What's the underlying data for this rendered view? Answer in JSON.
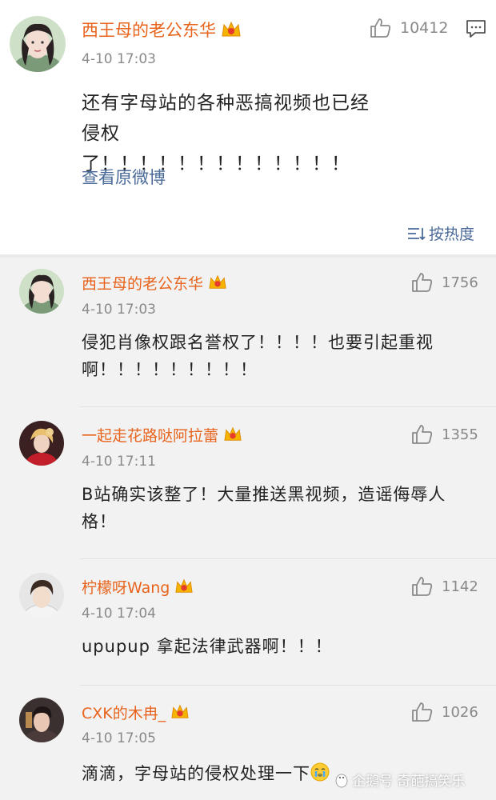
{
  "main_comment": {
    "username": "西王母的老公东华",
    "time": "4-10 17:03",
    "likes": "10412",
    "text": "还有字母站的各种恶搞视频也已经侵权了！！！！！！！！！！！！！",
    "view_original": "查看原微博",
    "sort_label": "按热度"
  },
  "comments": [
    {
      "username": "西王母的老公东华",
      "time": "4-10 17:03",
      "likes": "1756",
      "text": "侵犯肖像权跟名誉权了！！！！也要引起重视啊！！！！！！！！！"
    },
    {
      "username": "一起走花路哒阿拉蕾",
      "time": "4-10 17:11",
      "likes": "1355",
      "text": "B站确实该整了！大量推送黑视频，造谣侮辱人格！"
    },
    {
      "username": "柠檬呀Wang",
      "time": "4-10 17:04",
      "likes": "1142",
      "text": "upupup 拿起法律武器啊！！！"
    },
    {
      "username": "CXK的木冉_",
      "time": "4-10 17:05",
      "likes": "1026",
      "text": "滴滴，字母站的侵权处理一下"
    }
  ],
  "watermark": "企鹅号 奇葩搞笑乐",
  "colors": {
    "username": "#e8631c",
    "link": "#4a6a9a",
    "time": "#8a8a8a",
    "text": "#222222"
  }
}
